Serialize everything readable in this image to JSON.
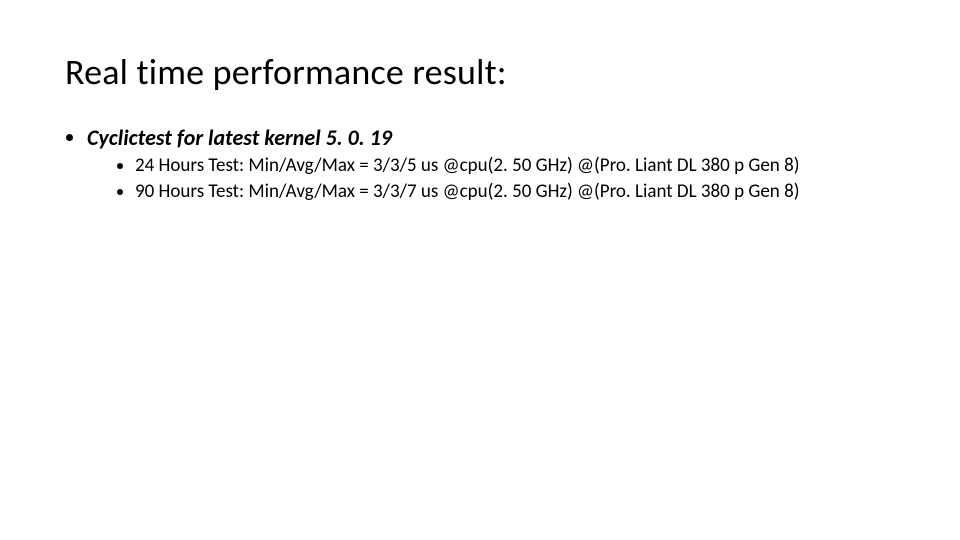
{
  "slide": {
    "title": "Real time performance result:",
    "section": {
      "heading": "Cyclictest for latest kernel 5. 0. 19",
      "items": [
        "24 Hours Test: Min/Avg/Max = 3/3/5 us @cpu(2. 50 GHz) @(Pro. Liant DL 380 p Gen 8)",
        "90 Hours Test: Min/Avg/Max = 3/3/7 us @cpu(2. 50 GHz) @(Pro. Liant DL 380 p Gen 8)"
      ]
    }
  }
}
